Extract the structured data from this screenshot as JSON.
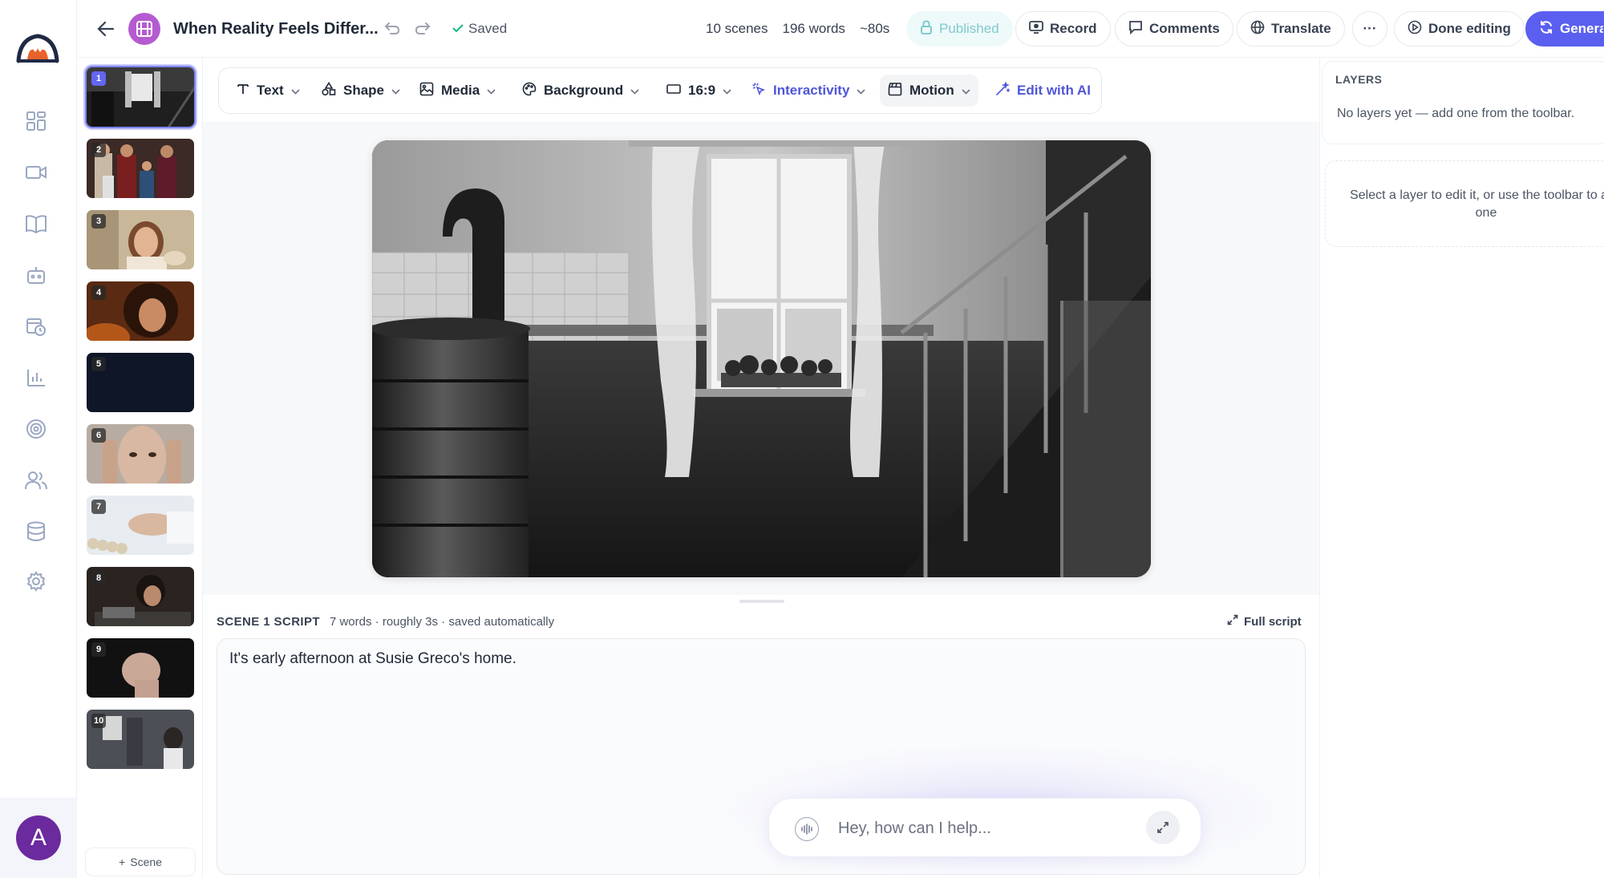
{
  "nav": {
    "items": [
      {
        "name": "dashboard",
        "icon": "grid-icon"
      },
      {
        "name": "videos",
        "icon": "video-camera-icon"
      },
      {
        "name": "library",
        "icon": "book-open-icon"
      },
      {
        "name": "avatars",
        "icon": "robot-icon"
      },
      {
        "name": "schedule",
        "icon": "calendar-clock-icon"
      },
      {
        "name": "analytics",
        "icon": "bar-chart-icon"
      },
      {
        "name": "goals",
        "icon": "target-icon"
      },
      {
        "name": "team",
        "icon": "users-icon"
      },
      {
        "name": "data",
        "icon": "database-icon"
      },
      {
        "name": "settings",
        "icon": "gear-icon"
      }
    ],
    "avatar_initial": "A",
    "brand_color": "#e8622c"
  },
  "header": {
    "project_title": "When Reality Feels Differ...",
    "save_status": "Saved",
    "stats": {
      "scenes": "10 scenes",
      "words": "196 words",
      "duration": "~80s"
    },
    "published_label": "Published",
    "record_label": "Record",
    "comments_label": "Comments",
    "translate_label": "Translate",
    "more_label": "···",
    "done_label": "Done editing",
    "generate_label": "Generate",
    "accent_color": "#5b5fef"
  },
  "toolbar": {
    "text": "Text",
    "shape": "Shape",
    "media": "Media",
    "background": "Background",
    "aspect_ratio": "16:9",
    "interactivity": "Interactivity",
    "motion": "Motion",
    "edit_ai": "Edit with AI"
  },
  "scenes": {
    "active_index": 1,
    "thumbnails": [
      {
        "number": "1",
        "theme": "kitchen-interior"
      },
      {
        "number": "2",
        "theme": "family-portrait"
      },
      {
        "number": "3",
        "theme": "smiling-woman"
      },
      {
        "number": "4",
        "theme": "curly-hair-woman"
      },
      {
        "number": "5",
        "theme": "dark-navy"
      },
      {
        "number": "6",
        "theme": "hands-on-temples"
      },
      {
        "number": "7",
        "theme": "pills-in-hand"
      },
      {
        "number": "8",
        "theme": "woman-at-table"
      },
      {
        "number": "9",
        "theme": "clenched-fist"
      },
      {
        "number": "10",
        "theme": "kitchen-woman"
      }
    ],
    "add_label": "Scene"
  },
  "script": {
    "title": "SCENE 1 SCRIPT",
    "meta": "7 words · roughly 3s · saved automatically",
    "full_script_label": "Full script",
    "text": "It's early afternoon at Susie Greco's home."
  },
  "assistant": {
    "placeholder": "Hey, how can I help..."
  },
  "layers": {
    "title": "LAYERS",
    "empty_text": "No layers yet — add one from the toolbar.",
    "hint": "Select a layer to edit it, or use the toolbar to add one"
  }
}
